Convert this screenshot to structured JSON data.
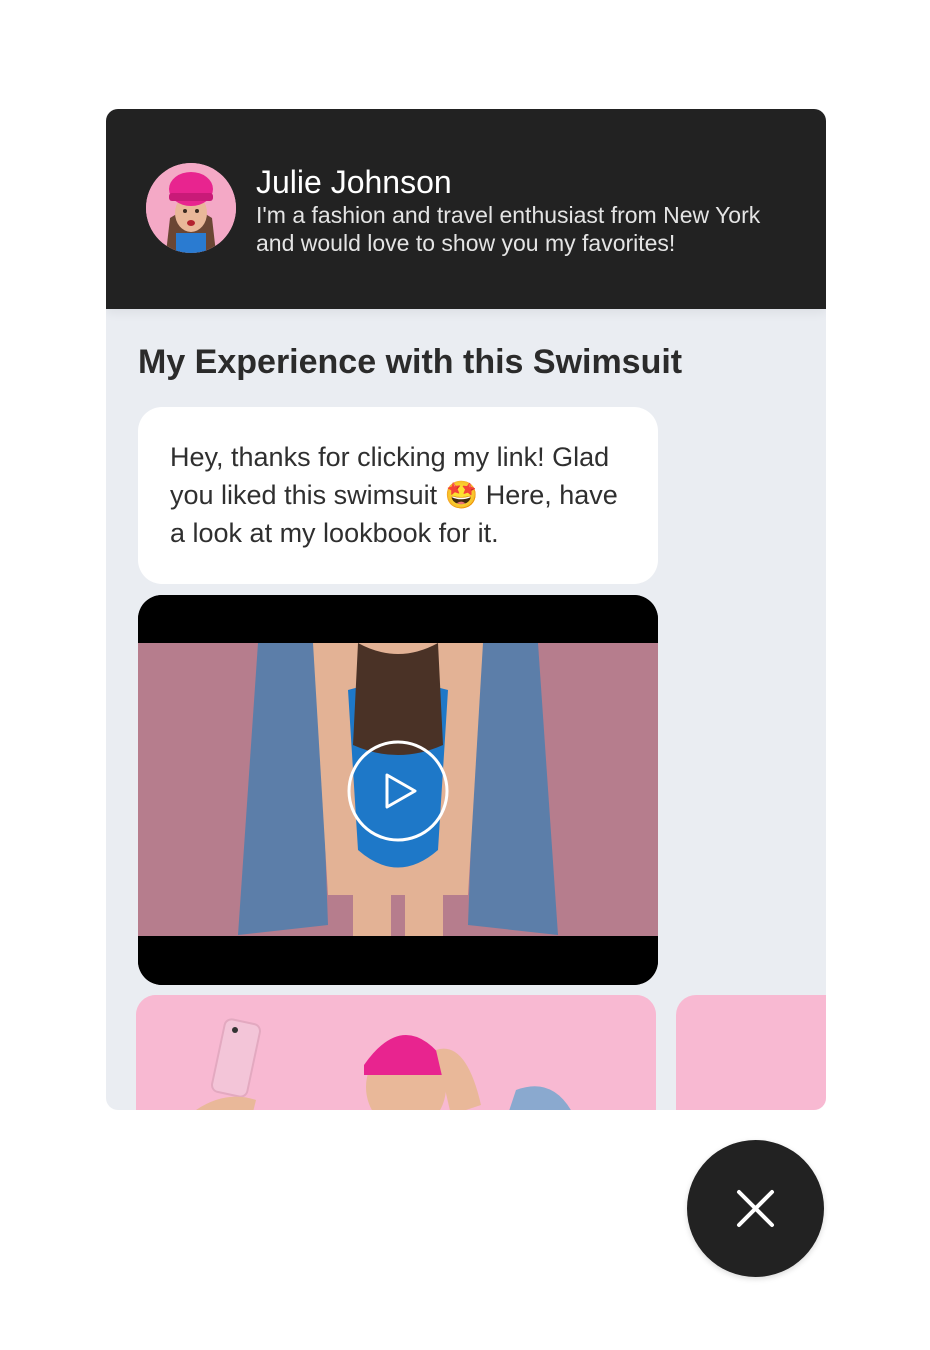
{
  "profile": {
    "name": "Julie Johnson",
    "bio": "I'm a fashion and travel enthusiast from New York and would love to show you my favorites!"
  },
  "section": {
    "title": "My Experience with this Swimsuit"
  },
  "message": {
    "text": "Hey, thanks for clicking my link! Glad you liked this swimsuit 🤩 Here, have a look at my lookbook for it."
  },
  "icons": {
    "play": "play-icon",
    "close": "close-icon"
  },
  "colors": {
    "header_bg": "#222222",
    "panel_bg": "#eaedf2",
    "card_pink": "#f8b9d2",
    "hat_magenta": "#e8248f",
    "swimsuit_blue": "#1e78c8"
  }
}
